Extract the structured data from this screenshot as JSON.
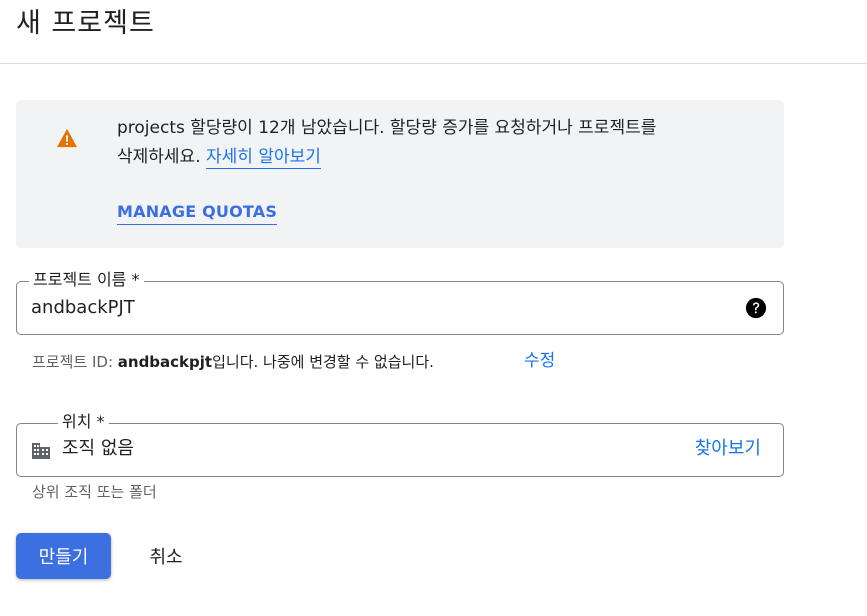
{
  "header": {
    "title": "새 프로젝트"
  },
  "notice": {
    "message_line1": "projects 할당량이 12개 남았습니다. 할당량 증가를 요청하거나 프로젝트를",
    "message_line2": "삭제하세요.",
    "learn_more": "자세히 알아보기",
    "manage_quotas": "MANAGE QUOTAS",
    "icon": "warning-icon",
    "icon_color": "#e37400"
  },
  "project_name": {
    "label": "프로젝트 이름 *",
    "value": "andbackPJT",
    "help_icon": "help-circle-icon"
  },
  "project_id_hint": {
    "prefix": "프로젝트 ID: ",
    "id": "andbackpjt",
    "suffix": "입니다. 나중에 변경할 수 없습니다.",
    "edit": "수정"
  },
  "location": {
    "label": "위치 *",
    "value": "조직 없음",
    "browse": "찾아보기",
    "hint": "상위 조직 또는 폴더",
    "icon": "organization-icon"
  },
  "actions": {
    "create": "만들기",
    "cancel": "취소"
  },
  "colors": {
    "primary": "#3c70e0",
    "link": "#1a73e8"
  }
}
